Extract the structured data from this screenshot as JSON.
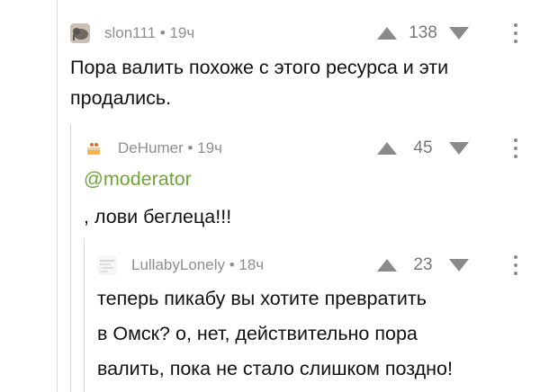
{
  "comments": [
    {
      "author": "slon111",
      "time": "19ч",
      "rating": "138",
      "avatar_icon": "elephant-avatar-icon",
      "text_lines": [
        "Пора валить похоже с этого ресурса и эти",
        "продались."
      ]
    },
    {
      "author": "DeHumer",
      "time": "19ч",
      "rating": "45",
      "avatar_icon": "cake-avatar-icon",
      "mention": "@moderator",
      "text_lines": [
        ", лови беглеца!!!"
      ]
    },
    {
      "author": "LullabyLonely",
      "time": "18ч",
      "rating": "23",
      "avatar_icon": "sketch-avatar-icon",
      "text_lines": [
        "теперь пикабу вы хотите превратить",
        "в Омск? о, нет, действительно пора",
        "валить, пока не стало слишком поздно!"
      ]
    }
  ],
  "separator": "•",
  "colors": {
    "meta": "#8e8e8e",
    "mention": "#72a43a",
    "thread_line": "#d8d8d8",
    "icon": "#8a8a8a"
  }
}
